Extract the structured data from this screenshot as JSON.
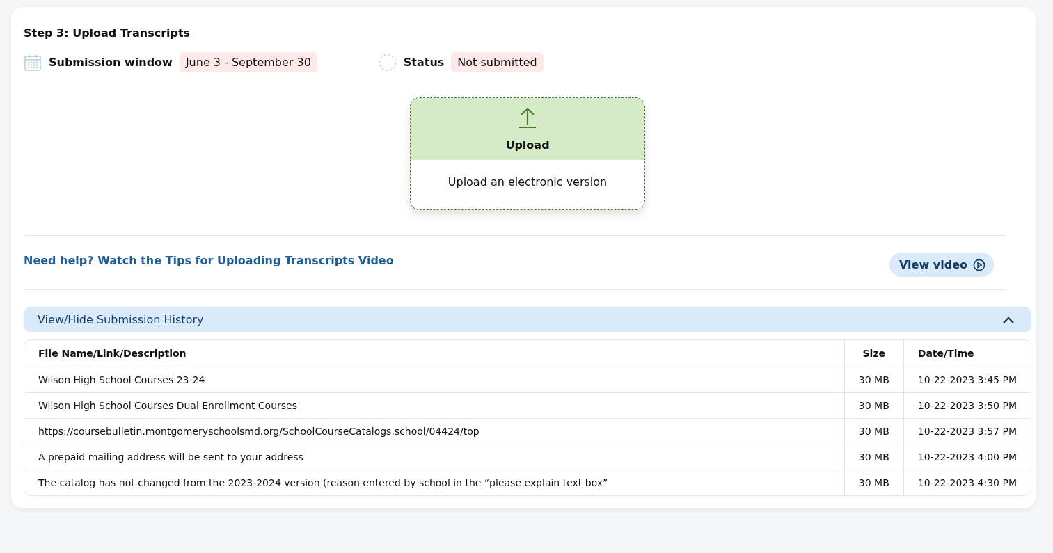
{
  "title": "Step 3: Upload Transcripts",
  "submission_window": {
    "label": "Submission window",
    "value": "June 3 - September 30"
  },
  "status": {
    "label": "Status",
    "value": "Not submitted"
  },
  "upload": {
    "title": "Upload",
    "description": "Upload an electronic version"
  },
  "help": {
    "link": "Need help? Watch the Tips for Uploading Transcripts Video",
    "button": "View video"
  },
  "history": {
    "label": "View/Hide Submission History",
    "expanded": true,
    "columns": [
      "File Name/Link/Description",
      "Size",
      "Date/Time"
    ],
    "rows": [
      {
        "name": "Wilson High School Courses 23-24",
        "size": "30 MB",
        "date": "10-22-2023 3:45 PM"
      },
      {
        "name": "Wilson High School Courses Dual Enrollment Courses",
        "size": "30 MB",
        "date": "10-22-2023 3:50 PM"
      },
      {
        "name": "https://coursebulletin.montgomeryschoolsmd.org/SchoolCourseCatalogs.school/04424/top",
        "size": "30 MB",
        "date": "10-22-2023 3:57 PM"
      },
      {
        "name": "A prepaid mailing address will be sent to your address",
        "size": "30 MB",
        "date": "10-22-2023 4:00 PM"
      },
      {
        "name": "The catalog has not changed from the 2023-2024 version (reason entered by school in the “please explain text box”",
        "size": "30 MB",
        "date": "10-22-2023 4:30 PM"
      }
    ]
  }
}
